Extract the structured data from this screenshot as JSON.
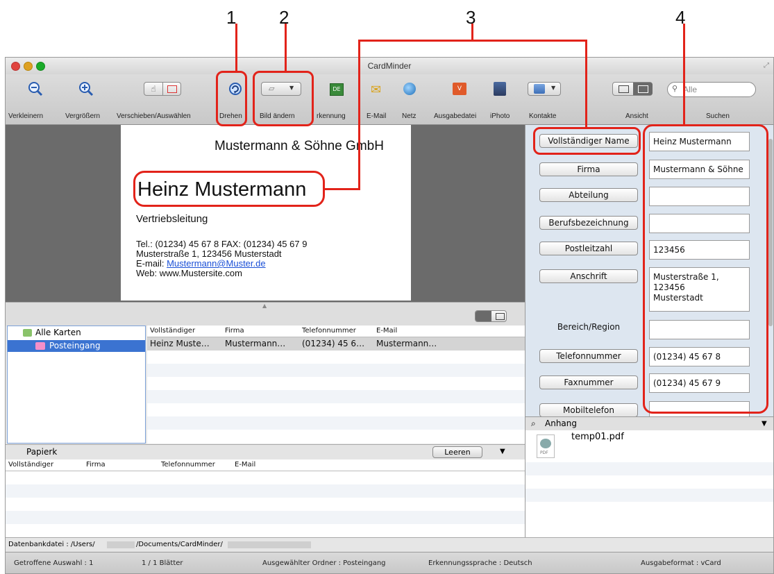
{
  "callouts": [
    "1",
    "2",
    "3",
    "4"
  ],
  "window": {
    "title": "CardMinder"
  },
  "toolbar": {
    "zoom_out": "Verkleinern",
    "zoom_in": "Vergrößern",
    "move_select": "Verschieben/Auswählen",
    "rotate": "Drehen",
    "change_image": "Bild ändern",
    "recognition": "rkennung",
    "email": "E-Mail",
    "net": "Netz",
    "output_file": "Ausgabedatei",
    "iphoto": "iPhoto",
    "contacts": "Kontakte",
    "view": "Ansicht",
    "search": "Suchen",
    "search_placeholder": "Alle"
  },
  "card": {
    "company": "Mustermann & Söhne GmbH",
    "name": "Heinz Mustermann",
    "position": "Vertriebsleitung",
    "line1": "Tel.: (01234) 45 67 8 FAX: (01234) 45 67 9",
    "line2": "Musterstraße 1, 123456 Musterstadt",
    "email_prefix": "E-mail: ",
    "email": "Mustermann@Muster.de",
    "web": "Web: www.Mustersite.com"
  },
  "tree": {
    "all_cards": "Alle Karten",
    "inbox": "Posteingang"
  },
  "table1": {
    "headers": [
      "Vollständiger",
      "Firma",
      "Telefonnummer",
      "E-Mail"
    ],
    "rows": [
      [
        "Heinz Muste…",
        "Mustermann…",
        "(01234) 45 6…",
        "Mustermann…"
      ]
    ]
  },
  "papierkorb": {
    "label": "Papierk",
    "clear": "Leeren",
    "headers": [
      "Vollständiger",
      "Firma",
      "Telefonnummer",
      "E-Mail"
    ]
  },
  "fields": [
    {
      "label": "Vollständiger Name",
      "value": "Heinz Mustermann"
    },
    {
      "label": "Firma",
      "value": "Mustermann & Söhne"
    },
    {
      "label": "Abteilung",
      "value": ""
    },
    {
      "label": "Berufsbezeichnung",
      "value": ""
    },
    {
      "label": "Postleitzahl",
      "value": "123456"
    },
    {
      "label": "Anschrift",
      "value": "Musterstraße 1, 123456 Musterstadt"
    },
    {
      "label": "Bereich/Region",
      "value": ""
    },
    {
      "label": "Telefonnummer",
      "value": "(01234) 45 67 8"
    },
    {
      "label": "Faxnummer",
      "value": "(01234) 45 67 9"
    },
    {
      "label": "Mobiltelefon",
      "value": ""
    }
  ],
  "anschrift_lines": [
    "Musterstraße 1,",
    "123456",
    "Musterstadt"
  ],
  "anhang": {
    "label": "Anhang",
    "file": "temp01.pdf",
    "file_type": "PDF"
  },
  "db": {
    "prefix": "Datenbankdatei : /Users/",
    "path": "/Documents/CardMinder/"
  },
  "status": {
    "selection": "Getroffene Auswahl : 1",
    "sheets": "1 / 1 Blätter",
    "folder": "Ausgewählter Ordner : Posteingang",
    "language": "Erkennungssprache : Deutsch",
    "format": "Ausgabeformat : vCard"
  },
  "colors": {
    "callout_red": "#e2231a",
    "selection_blue": "#3b73d1",
    "link_blue": "#1a4fd6"
  }
}
